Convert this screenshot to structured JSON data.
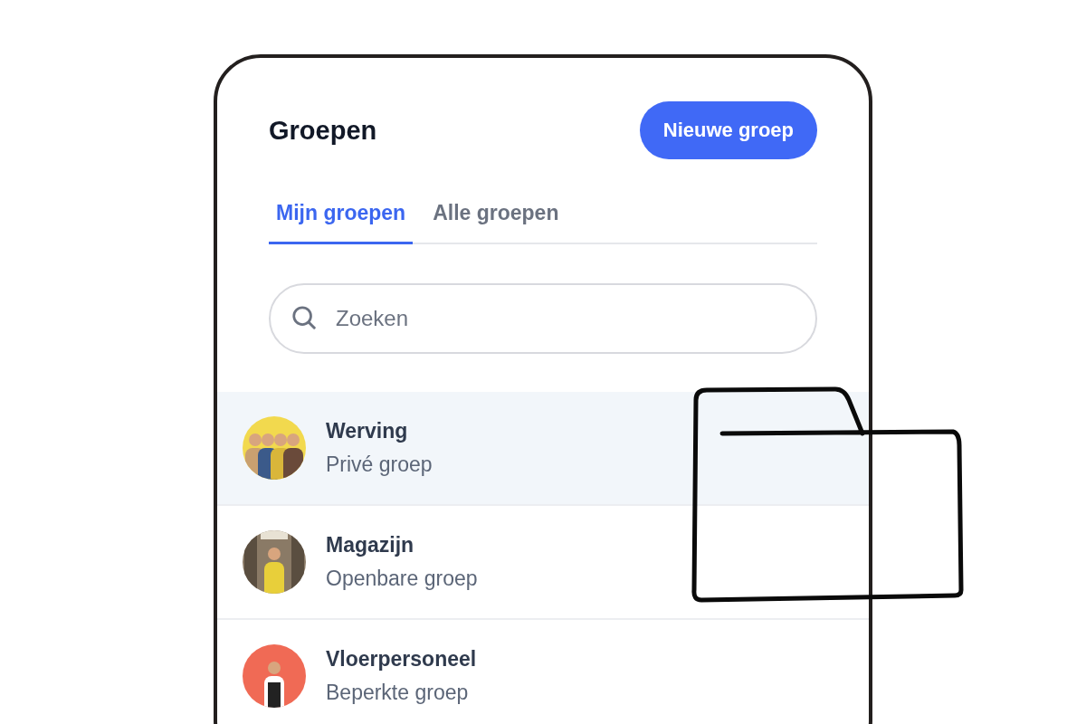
{
  "header": {
    "title": "Groepen",
    "new_button": "Nieuwe groep"
  },
  "tabs": [
    {
      "label": "Mijn groepen",
      "selected": true
    },
    {
      "label": "Alle groepen",
      "selected": false
    }
  ],
  "search": {
    "placeholder": "Zoeken"
  },
  "groups": [
    {
      "name": "Werving",
      "type": "Privé groep",
      "selected": true
    },
    {
      "name": "Magazijn",
      "type": "Openbare groep",
      "selected": false
    },
    {
      "name": "Vloerpersoneel",
      "type": "Beperkte groep",
      "selected": false
    }
  ]
}
